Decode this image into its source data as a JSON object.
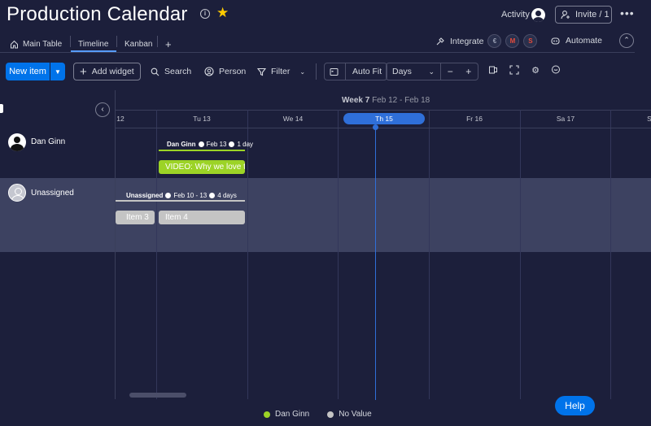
{
  "header": {
    "title": "Production Calendar",
    "activity_label": "Activity",
    "invite_label": "Invite / 1"
  },
  "tabs": [
    {
      "label": "Main Table",
      "icon": "home-icon"
    },
    {
      "label": "Timeline",
      "active": true
    },
    {
      "label": "Kanban"
    }
  ],
  "integrations": {
    "integrate_label": "Integrate",
    "automate_label": "Automate"
  },
  "toolbar": {
    "new_item": "New item",
    "add_widget": "Add widget",
    "search": "Search",
    "person": "Person",
    "filter": "Filter",
    "auto_fit": "Auto Fit",
    "days": "Days"
  },
  "timeline": {
    "week_label": "Week 7",
    "week_range": "Feb 12 - Feb 18",
    "days": [
      "12",
      "Tu 13",
      "We 14",
      "Th 15",
      "Fr 16",
      "Sa 17",
      "S"
    ],
    "today": "Th 15",
    "groups": [
      {
        "name": "Dan Ginn",
        "summary_name": "Dan Ginn",
        "summary_date": "Feb 13",
        "summary_duration": "1 day",
        "color": "#9cd326",
        "items": [
          {
            "label": "VIDEO: Why we love t",
            "color": "#9cd326"
          }
        ]
      },
      {
        "name": "Unassigned",
        "summary_name": "Unassigned",
        "summary_date": "Feb 10 - 13",
        "summary_duration": "4 days",
        "color": "#c4c4c4",
        "items": [
          {
            "label": "Item 3",
            "color": "#c4c4c4"
          },
          {
            "label": "Item 4",
            "color": "#c4c4c4"
          }
        ]
      }
    ]
  },
  "legend": [
    {
      "label": "Dan Ginn",
      "color": "#9cd326"
    },
    {
      "label": "No Value",
      "color": "#c4c4c4"
    }
  ],
  "help_label": "Help"
}
